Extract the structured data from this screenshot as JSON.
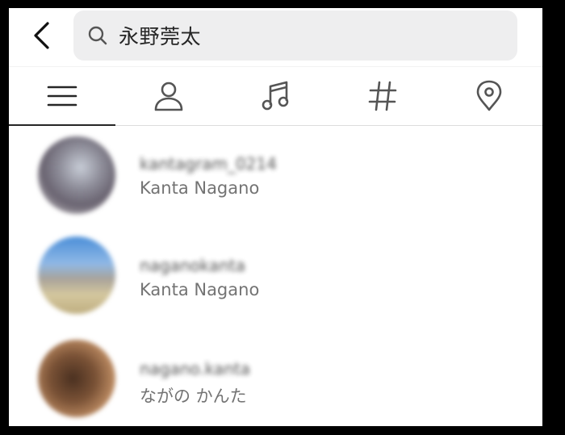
{
  "header": {
    "back_icon": "chevron-left-icon",
    "search": {
      "icon": "search-icon",
      "value": "永野莞太"
    }
  },
  "tabs": [
    {
      "name": "top",
      "icon": "menu-lines-icon",
      "active": true
    },
    {
      "name": "accounts",
      "icon": "person-icon",
      "active": false
    },
    {
      "name": "audio",
      "icon": "music-note-icon",
      "active": false
    },
    {
      "name": "tags",
      "icon": "hashtag-icon",
      "active": false
    },
    {
      "name": "places",
      "icon": "location-pin-icon",
      "active": false
    }
  ],
  "results": [
    {
      "username": "kantagram_0214",
      "full_name": "Kanta Nagano"
    },
    {
      "username": "naganokanta",
      "full_name": "Kanta Nagano"
    },
    {
      "username": "nagano.kanta",
      "full_name": "ながの かんた"
    }
  ],
  "colors": {
    "text_primary": "#262626",
    "text_secondary": "#737373",
    "search_bg": "#eeeeef",
    "divider": "#dcdcdc",
    "frame": "#000000"
  }
}
